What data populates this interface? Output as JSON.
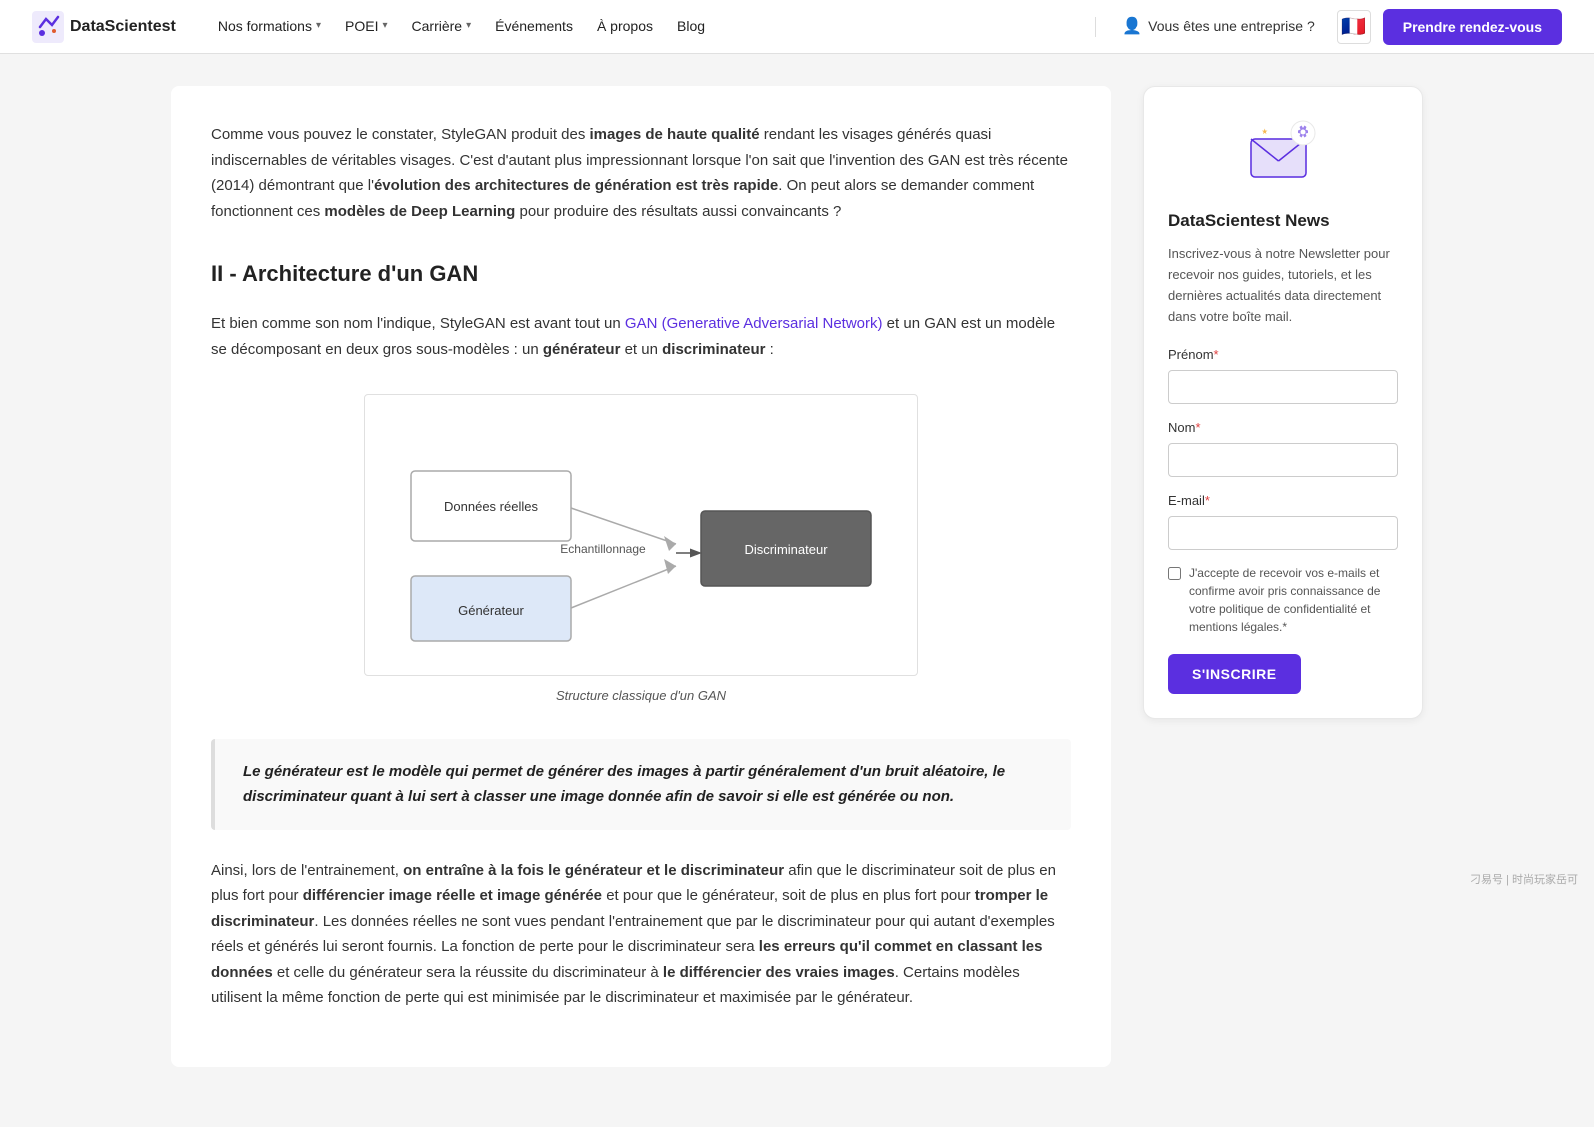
{
  "navbar": {
    "logo_text": "DataScientest",
    "nav_items": [
      {
        "label": "Nos formations",
        "has_dropdown": true
      },
      {
        "label": "POEI",
        "has_dropdown": true
      },
      {
        "label": "Carrière",
        "has_dropdown": true
      },
      {
        "label": "Événements",
        "has_dropdown": false
      },
      {
        "label": "À propos",
        "has_dropdown": false
      },
      {
        "label": "Blog",
        "has_dropdown": false
      }
    ],
    "enterprise_label": "Vous êtes une entreprise ?",
    "cta_label": "Prendre rendez-vous"
  },
  "article": {
    "intro_text_1": "Comme vous pouvez le constater, StyleGAN produit des ",
    "intro_bold_1": "images de haute qualité",
    "intro_text_2": " rendant les visages générés quasi indiscernables de véritables visages. C'est d'autant plus impressionnant lorsque l'on sait que l'invention des GAN est très récente (2014) démontrant que l'",
    "intro_bold_2": "évolution des architectures de génération est très rapide",
    "intro_text_3": ". On peut alors se demander comment fonctionnent ces ",
    "intro_bold_3": "modèles de Deep Learning",
    "intro_text_4": " pour produire des résultats aussi convaincants ?",
    "section_heading": "II - Architecture d'un GAN",
    "body1_text_1": "Et bien comme son nom l'indique, StyleGAN est avant tout un ",
    "body1_link": "GAN (Generative Adversarial Network)",
    "body1_text_2": " et un GAN est un modèle se décomposant en deux gros sous-modèles : un ",
    "body1_bold_1": "générateur",
    "body1_text_3": " et un ",
    "body1_bold_2": "discriminateur",
    "body1_text_4": " :",
    "diagram_caption": "Structure classique d'un GAN",
    "diagram_nodes": {
      "donnees_label": "Données réelles",
      "echantillonnage_label": "Echantillonnage",
      "discriminateur_label": "Discriminateur",
      "generateur_label": "Générateur"
    },
    "blockquote": "Le générateur est le modèle qui permet de générer des images à partir généralement d'un bruit aléatoire, le discriminateur quant à lui sert à classer une image donnée afin de savoir si elle est générée ou non.",
    "body2_text_1": "Ainsi, lors de l'entrainement, ",
    "body2_bold_1": "on entraîne à la fois le générateur et le discriminateur",
    "body2_text_2": " afin que le discriminateur soit de plus en plus fort pour ",
    "body2_bold_2": "différencier image réelle et image générée",
    "body2_text_3": " et pour que le générateur, soit de plus en plus fort pour ",
    "body2_bold_3": "tromper le discriminateur",
    "body2_text_4": ". Les données réelles ne sont vues pendant l'entrainement que par le discriminateur pour qui autant d'exemples réels et générés lui seront fournis. La fonction de perte pour le discriminateur sera ",
    "body2_bold_4": "les erreurs qu'il commet en classant les données",
    "body2_text_5": " et celle du générateur sera la réussite du discriminateur à ",
    "body2_bold_5": "le différencier des vraies images",
    "body2_text_6": ". Certains modèles utilisent la même fonction de perte qui est minimisée par le discriminateur et maximisée par le générateur."
  },
  "sidebar": {
    "card_title": "DataScientest News",
    "card_desc": "Inscrivez-vous à notre Newsletter pour recevoir nos guides, tutoriels, et les dernières actualités data directement dans votre boîte mail.",
    "prenom_label": "Prénom",
    "prenom_required": "*",
    "nom_label": "Nom",
    "nom_required": "*",
    "email_label": "E-mail",
    "email_required": "*",
    "checkbox_text": "J'accepte de recevoir vos e-mails et confirme avoir pris connaissance de votre politique de confidentialité et mentions légales.",
    "checkbox_required": "*",
    "submit_label": "S'INSCRIRE"
  },
  "watermark": "刁易号 | 时尚玩家岳可"
}
